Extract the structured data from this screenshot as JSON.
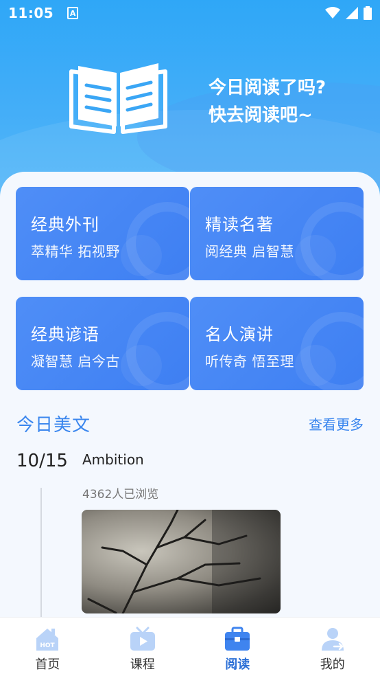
{
  "status_bar": {
    "time": "11:05",
    "notification_badge": "A"
  },
  "hero": {
    "line1": "今日阅读了吗?",
    "line2": "快去阅读吧~"
  },
  "categories": [
    {
      "title": "经典外刊",
      "subtitle": "萃精华 拓视野"
    },
    {
      "title": "精读名著",
      "subtitle": "阅经典 启智慧"
    },
    {
      "title": "经典谚语",
      "subtitle": "凝智慧 启今古"
    },
    {
      "title": "名人演讲",
      "subtitle": "听传奇 悟至理"
    }
  ],
  "daily_article": {
    "section_title": "今日美文",
    "more_label": "查看更多",
    "date": "10/15",
    "title": "Ambition",
    "views": "4362人已浏览"
  },
  "tabbar": {
    "items": [
      {
        "label": "首页",
        "icon": "home-hot-icon"
      },
      {
        "label": "课程",
        "icon": "tv-play-icon"
      },
      {
        "label": "阅读",
        "icon": "briefcase-icon"
      },
      {
        "label": "我的",
        "icon": "user-icon"
      }
    ],
    "active_index": 2
  },
  "colors": {
    "accent": "#3a86ee",
    "card": "#4f8ef7",
    "tab_inactive_icon": "#b9d3f8",
    "tab_active_icon": "#3f84ef"
  }
}
